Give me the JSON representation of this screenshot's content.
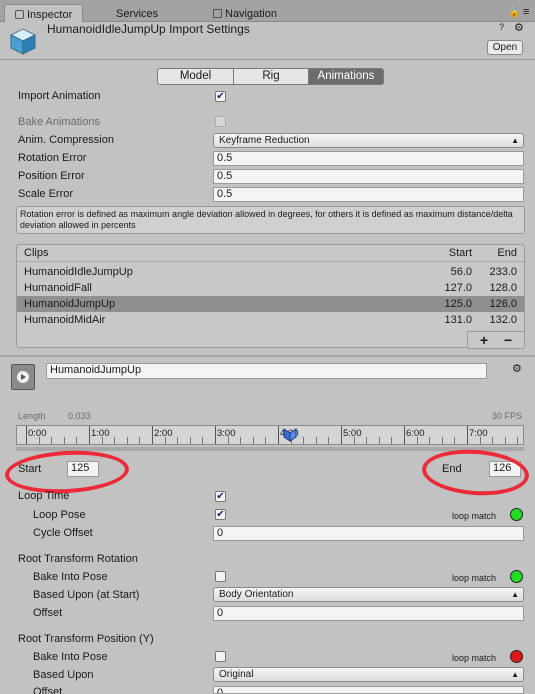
{
  "tabs": {
    "inspector": "Inspector",
    "services": "Services",
    "navigation": "Navigation"
  },
  "header": {
    "title": "HumanoidIdleJumpUp Import Settings",
    "open_label": "Open"
  },
  "modes": [
    "Model",
    "Rig",
    "Animations"
  ],
  "settings": {
    "import_animation": "Import Animation",
    "bake_animations": "Bake Animations",
    "anim_compression": "Anim. Compression",
    "anim_compression_value": "Keyframe Reduction",
    "rotation_error": "Rotation Error",
    "rotation_error_value": "0.5",
    "position_error": "Position Error",
    "position_error_value": "0.5",
    "scale_error": "Scale Error",
    "scale_error_value": "0.5",
    "help": "Rotation error is defined as maximum angle deviation allowed in degrees, for others it is defined as maximum distance/delta deviation allowed in percents"
  },
  "clips": {
    "header_clips": "Clips",
    "header_start": "Start",
    "header_end": "End",
    "rows": [
      {
        "name": "HumanoidIdleJumpUp",
        "start": "56.0",
        "end": "233.0"
      },
      {
        "name": "HumanoidFall",
        "start": "127.0",
        "end": "128.0"
      },
      {
        "name": "HumanoidJumpUp",
        "start": "125.0",
        "end": "126.0"
      },
      {
        "name": "HumanoidMidAir",
        "start": "131.0",
        "end": "132.0"
      }
    ],
    "add": "+",
    "remove": "−"
  },
  "clip": {
    "name": "HumanoidJumpUp",
    "length_label": "Length",
    "length_value": "0.033",
    "fps": "30 FPS",
    "timeline_ticks": [
      "0:00",
      "1:00",
      "2:00",
      "3:00",
      "4:00",
      "5:00",
      "6:00",
      "7:00"
    ],
    "playhead_fraction": 0.54,
    "start_label": "Start",
    "start_value": "125",
    "end_label": "End",
    "end_value": "126"
  },
  "loop": {
    "loop_time": "Loop Time",
    "loop_pose": "Loop Pose",
    "loop_match": "loop match",
    "cycle_offset": "Cycle Offset",
    "cycle_offset_value": "0"
  },
  "root_rotation": {
    "title": "Root Transform Rotation",
    "bake": "Bake Into Pose",
    "based_upon": "Based Upon (at Start)",
    "based_upon_value": "Body Orientation",
    "offset": "Offset",
    "offset_value": "0",
    "loop_match": "loop match"
  },
  "root_position_y": {
    "title": "Root Transform Position (Y)",
    "bake": "Bake Into Pose",
    "based_upon": "Based Upon",
    "based_upon_value": "Original",
    "offset": "Offset",
    "offset_value": "0",
    "loop_match": "loop match"
  },
  "colors": {
    "match_ok": "#22dd22",
    "match_bad": "#e01818",
    "annotation": "#ec2a38"
  }
}
